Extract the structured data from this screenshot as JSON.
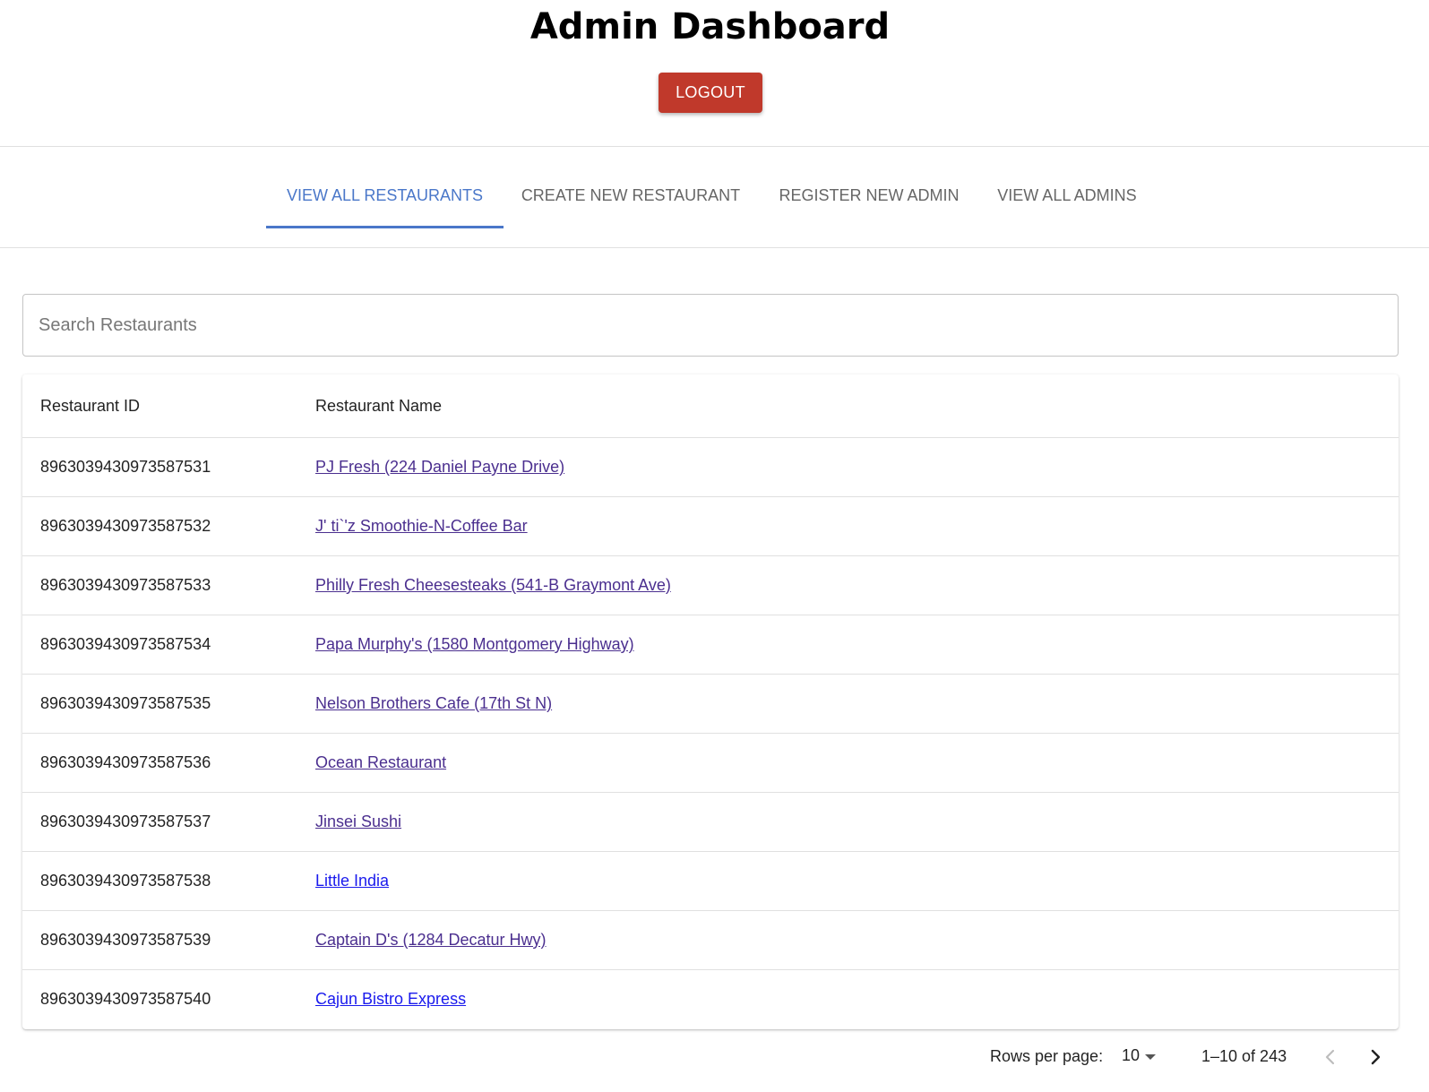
{
  "header": {
    "title": "Admin Dashboard",
    "logout_label": "LOGOUT"
  },
  "tabs": [
    {
      "label": "VIEW ALL RESTAURANTS",
      "active": true
    },
    {
      "label": "CREATE NEW RESTAURANT",
      "active": false
    },
    {
      "label": "REGISTER NEW ADMIN",
      "active": false
    },
    {
      "label": "VIEW ALL ADMINS",
      "active": false
    }
  ],
  "search": {
    "placeholder": "Search Restaurants",
    "value": ""
  },
  "table": {
    "columns": [
      "Restaurant ID",
      "Restaurant Name"
    ],
    "rows": [
      {
        "id": "8963039430973587531",
        "name": "PJ Fresh (224 Daniel Payne Drive)"
      },
      {
        "id": "8963039430973587532",
        "name": "J' ti`'z Smoothie-N-Coffee Bar"
      },
      {
        "id": "8963039430973587533",
        "name": "Philly Fresh Cheesesteaks (541-B Graymont Ave)"
      },
      {
        "id": "8963039430973587534",
        "name": "Papa Murphy's (1580 Montgomery Highway)"
      },
      {
        "id": "8963039430973587535",
        "name": "Nelson Brothers Cafe (17th St N)"
      },
      {
        "id": "8963039430973587536",
        "name": "Ocean Restaurant"
      },
      {
        "id": "8963039430973587537",
        "name": "Jinsei Sushi"
      },
      {
        "id": "8963039430973587538",
        "name": "Little India"
      },
      {
        "id": "8963039430973587539",
        "name": "Captain D's (1284 Decatur Hwy)"
      },
      {
        "id": "8963039430973587540",
        "name": "Cajun Bistro Express"
      }
    ]
  },
  "pagination": {
    "rows_per_page_label": "Rows per page:",
    "rows_per_page": "10",
    "range": "1–10 of 243"
  },
  "colors": {
    "logout": "#c0392b",
    "tab_active": "#4a77c9",
    "link_visited": "#4b2f8f",
    "link": "#1a1aed"
  },
  "icons": [
    "dropdown-arrow-icon",
    "chevron-left-icon",
    "chevron-right-icon"
  ]
}
